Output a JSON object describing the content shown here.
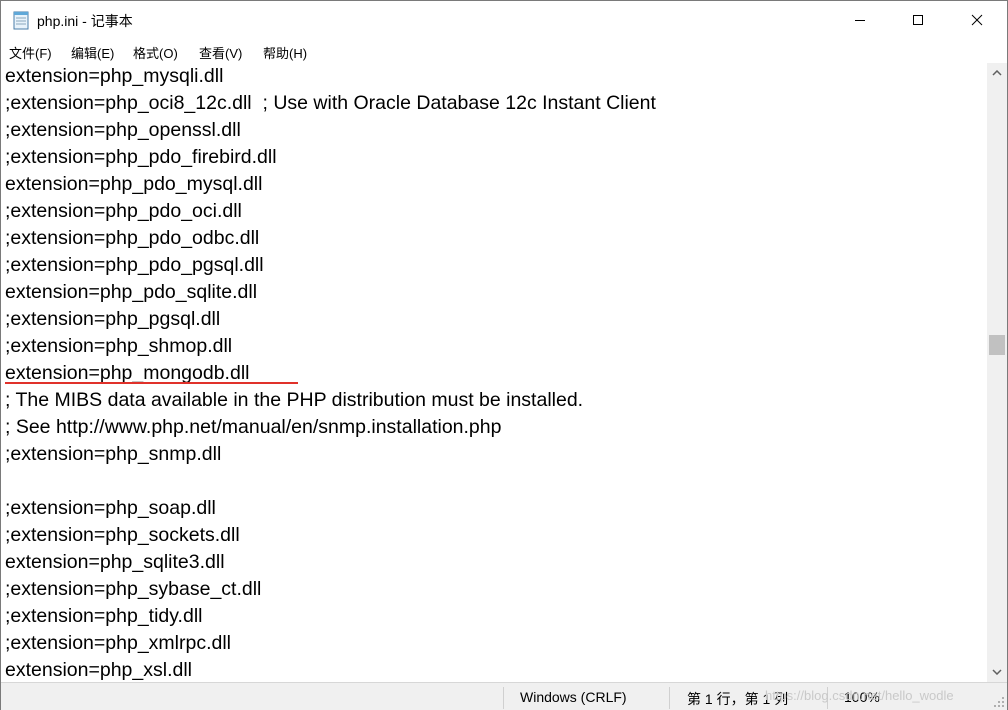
{
  "window": {
    "title": "php.ini - 记事本",
    "icon": "notepad-icon",
    "controls": [
      "minimize-icon",
      "maximize-icon",
      "close-icon"
    ]
  },
  "menu": [
    {
      "label": "文件(F)"
    },
    {
      "label": "编辑(E)"
    },
    {
      "label": "格式(O)"
    },
    {
      "label": "查看(V)"
    },
    {
      "label": "帮助(H)"
    }
  ],
  "lines": [
    {
      "text": "extension=php_mysqli.dll"
    },
    {
      "text": ";extension=php_oci8_12c.dll  ; Use with Oracle Database 12c Instant Client"
    },
    {
      "text": ";extension=php_openssl.dll"
    },
    {
      "text": ";extension=php_pdo_firebird.dll"
    },
    {
      "text": "extension=php_pdo_mysql.dll"
    },
    {
      "text": ";extension=php_pdo_oci.dll"
    },
    {
      "text": ";extension=php_pdo_odbc.dll"
    },
    {
      "text": ";extension=php_pdo_pgsql.dll"
    },
    {
      "text": "extension=php_pdo_sqlite.dll"
    },
    {
      "text": ";extension=php_pgsql.dll"
    },
    {
      "text": ";extension=php_shmop.dll"
    },
    {
      "text": "extension=php_mongodb.dll"
    },
    {
      "text": "; The MIBS data available in the PHP distribution must be installed."
    },
    {
      "text": "; See http://www.php.net/manual/en/snmp.installation.php"
    },
    {
      "text": ";extension=php_snmp.dll"
    },
    {
      "text": ""
    },
    {
      "text": ";extension=php_soap.dll"
    },
    {
      "text": ";extension=php_sockets.dll"
    },
    {
      "text": "extension=php_sqlite3.dll"
    },
    {
      "text": ";extension=php_sybase_ct.dll"
    },
    {
      "text": ";extension=php_tidy.dll"
    },
    {
      "text": ";extension=php_xmlrpc.dll"
    },
    {
      "text": "extension=php_xsl.dll"
    }
  ],
  "highlight": {
    "line": 12,
    "color": "#e0312a"
  },
  "status": {
    "encoding": "Windows (CRLF)",
    "position": "第 1 行，第 1 列",
    "zoom": "100%",
    "watermark": "https://blog.csdn.net/hello_wodle"
  }
}
